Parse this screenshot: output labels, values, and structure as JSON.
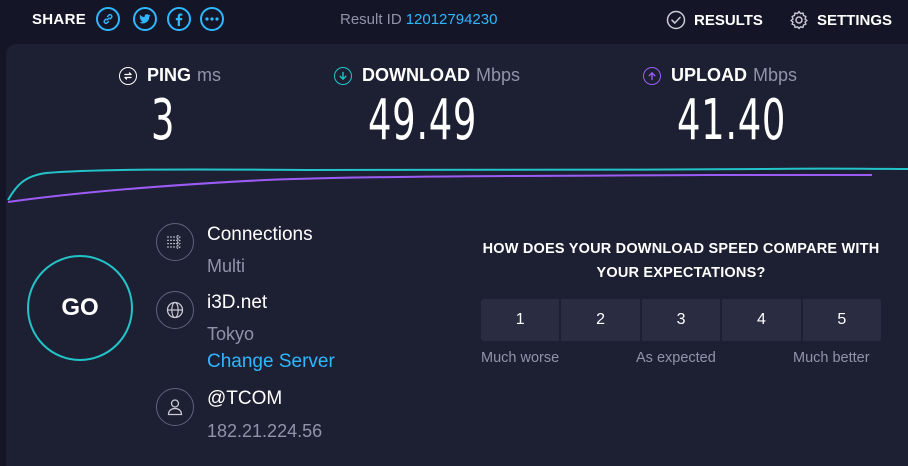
{
  "header": {
    "share_label": "SHARE",
    "share_icons": [
      "link-icon",
      "twitter-icon",
      "facebook-icon",
      "more-icon"
    ],
    "result_id_label": "Result ID",
    "result_id": "12012794230",
    "results_label": "RESULTS",
    "settings_label": "SETTINGS"
  },
  "metrics": {
    "ping": {
      "label": "PING",
      "unit": "ms",
      "value": "3"
    },
    "download": {
      "label": "DOWNLOAD",
      "unit": "Mbps",
      "value": "49.49"
    },
    "upload": {
      "label": "UPLOAD",
      "unit": "Mbps",
      "value": "41.40"
    }
  },
  "go_label": "GO",
  "connection": {
    "connections_title": "Connections",
    "connections_value": "Multi",
    "server_name": "i3D.net",
    "server_location": "Tokyo",
    "change_server_label": "Change Server",
    "isp_name": "@TCOM",
    "ip_address": "182.21.224.56"
  },
  "survey": {
    "question": "HOW DOES YOUR DOWNLOAD SPEED COMPARE WITH YOUR EXPECTATIONS?",
    "options": [
      "1",
      "2",
      "3",
      "4",
      "5"
    ],
    "low_label": "Much worse",
    "mid_label": "As expected",
    "high_label": "Much better"
  },
  "colors": {
    "accent": "#2fb7ff",
    "download": "#22c4c9",
    "upload": "#9b5cf6",
    "background": "#141526",
    "panel": "#1d2032"
  }
}
